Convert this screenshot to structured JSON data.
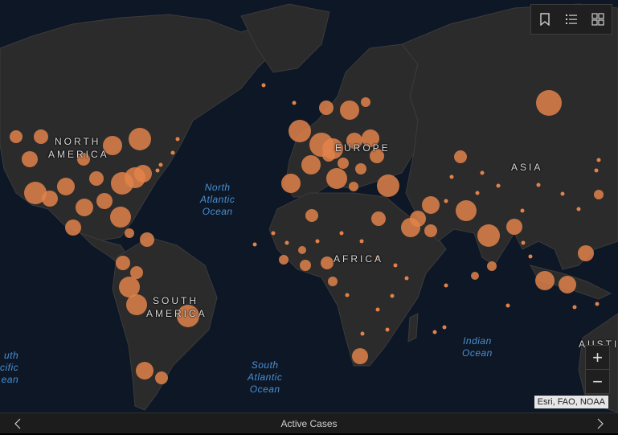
{
  "map": {
    "continents": [
      {
        "id": "north-america",
        "lines": [
          "NORTH",
          "AMERICA"
        ]
      },
      {
        "id": "south-america",
        "lines": [
          "SOUTH",
          "AMERICA"
        ]
      },
      {
        "id": "europe",
        "lines": [
          "EUROPE"
        ]
      },
      {
        "id": "africa",
        "lines": [
          "AFRICA"
        ]
      },
      {
        "id": "asia",
        "lines": [
          "ASIA"
        ]
      },
      {
        "id": "australia",
        "lines": [
          "AUSTI"
        ]
      }
    ],
    "oceans": [
      {
        "id": "north-atlantic",
        "lines": [
          "North",
          "Atlantic",
          "Ocean"
        ]
      },
      {
        "id": "south-atlantic",
        "lines": [
          "South",
          "Atlantic",
          "Ocean"
        ]
      },
      {
        "id": "indian",
        "lines": [
          "Indian",
          "Ocean"
        ]
      },
      {
        "id": "south-pacific",
        "lines": [
          "uth",
          "cific",
          "ean"
        ]
      }
    ],
    "colors": {
      "ocean": "#0d1725",
      "land": "#2b2b2b",
      "border": "#5a4a6a",
      "marker": "#e0834a"
    }
  },
  "toolbar": {
    "icons": [
      "bookmark-icon",
      "legend-list-icon",
      "basemap-gallery-icon"
    ]
  },
  "zoom": {
    "in_label": "+",
    "out_label": "−"
  },
  "attribution": "Esri, FAO, NOAA",
  "footer": {
    "title": "Active Cases",
    "prev_icon": "chevron-left-icon",
    "next_icon": "chevron-right-icon"
  }
}
